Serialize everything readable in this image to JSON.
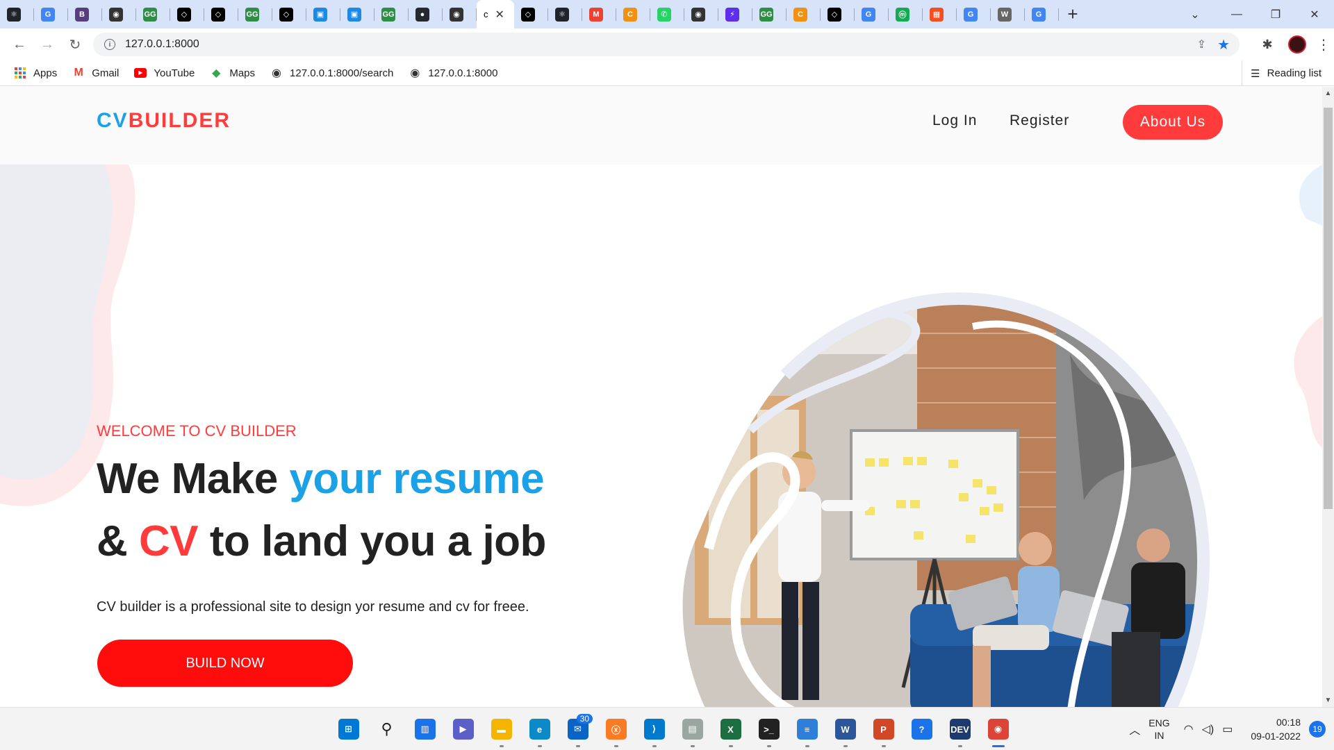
{
  "browser": {
    "tabs": [
      {
        "icon": "react-icon",
        "color": "#20232a"
      },
      {
        "icon": "google-icon",
        "color": "#4285f4"
      },
      {
        "icon": "bootstrap-icon",
        "color": "#563d7c"
      },
      {
        "icon": "globe-icon",
        "color": "#333333"
      },
      {
        "icon": "geeksforgeeks-icon",
        "color": "#2f8d46"
      },
      {
        "icon": "codepen-icon",
        "color": "#000000"
      },
      {
        "icon": "codepen-icon",
        "color": "#000000"
      },
      {
        "icon": "geeksforgeeks-icon",
        "color": "#2f8d46"
      },
      {
        "icon": "codepen-icon",
        "color": "#000000"
      },
      {
        "icon": "cube-icon",
        "color": "#1e88e5"
      },
      {
        "icon": "cube-icon",
        "color": "#1e88e5"
      },
      {
        "icon": "geeksforgeeks-icon",
        "color": "#2f8d46"
      },
      {
        "icon": "github-icon",
        "color": "#24292e"
      },
      {
        "icon": "globe-icon",
        "color": "#333333"
      },
      {
        "icon": "codepen-icon",
        "color": "#000000"
      },
      {
        "icon": "react-icon",
        "color": "#20232a"
      },
      {
        "icon": "gmail-icon",
        "color": "#ea4335"
      },
      {
        "icon": "coursera-icon",
        "color": "#f29111"
      },
      {
        "icon": "whatsapp-icon",
        "color": "#25d366"
      },
      {
        "icon": "globe-icon",
        "color": "#333333"
      },
      {
        "icon": "lightning-icon",
        "color": "#5f2eea"
      },
      {
        "icon": "geeksforgeeks-icon",
        "color": "#2f8d46"
      },
      {
        "icon": "coursera-icon",
        "color": "#f29111"
      },
      {
        "icon": "codepen-icon",
        "color": "#000000"
      },
      {
        "icon": "google-icon",
        "color": "#4285f4"
      },
      {
        "icon": "mongodb-icon",
        "color": "#13aa52"
      },
      {
        "icon": "microsoft-icon",
        "color": "#f25022"
      },
      {
        "icon": "google-icon",
        "color": "#4285f4"
      },
      {
        "icon": "wikipedia-icon",
        "color": "#666666"
      },
      {
        "icon": "google-icon",
        "color": "#4285f4"
      }
    ],
    "active_tab_letter": "c",
    "url": "127.0.0.1:8000",
    "bookmarks": [
      {
        "label": "Apps",
        "icon": "apps-grid-icon"
      },
      {
        "label": "Gmail",
        "icon": "gmail-icon"
      },
      {
        "label": "YouTube",
        "icon": "youtube-icon"
      },
      {
        "label": "Maps",
        "icon": "maps-icon"
      },
      {
        "label": "127.0.0.1:8000/search",
        "icon": "globe-icon"
      },
      {
        "label": "127.0.0.1:8000",
        "icon": "globe-icon"
      }
    ],
    "reading_list": "Reading list"
  },
  "site": {
    "logo_cv": "CV",
    "logo_builder": "BUILDER",
    "nav": {
      "login": "Log In",
      "register": "Register",
      "about": "About Us"
    },
    "hero": {
      "eyebrow": "WELCOME TO CV BUILDER",
      "line1_a": "We Make ",
      "line1_b": "your resume",
      "line2_a": "& ",
      "line2_b": "CV",
      "line2_c": " to land you a job",
      "subtitle": "CV builder is a professional site to design yor resume and cv for freee.",
      "cta": "BUILD NOW"
    },
    "colors": {
      "primary_red": "#ff3b3b",
      "primary_blue": "#1ba1e6",
      "cta_red": "#ff0d0d"
    }
  },
  "taskbar": {
    "apps": [
      "windows-start-icon",
      "search-icon",
      "widgets-icon",
      "teams-chat-icon",
      "file-explorer-icon",
      "edge-icon",
      "mail-icon",
      "xampp-icon",
      "vscode-icon",
      "notepad-icon",
      "excel-icon",
      "terminal-icon",
      "notepad-app-icon",
      "word-icon",
      "powerpoint-icon",
      "help-icon",
      "devcpp-icon",
      "chrome-icon"
    ],
    "mail_badge": "30",
    "lang_1": "ENG",
    "lang_2": "IN",
    "time": "00:18",
    "date": "09-01-2022",
    "notifications": "19"
  }
}
